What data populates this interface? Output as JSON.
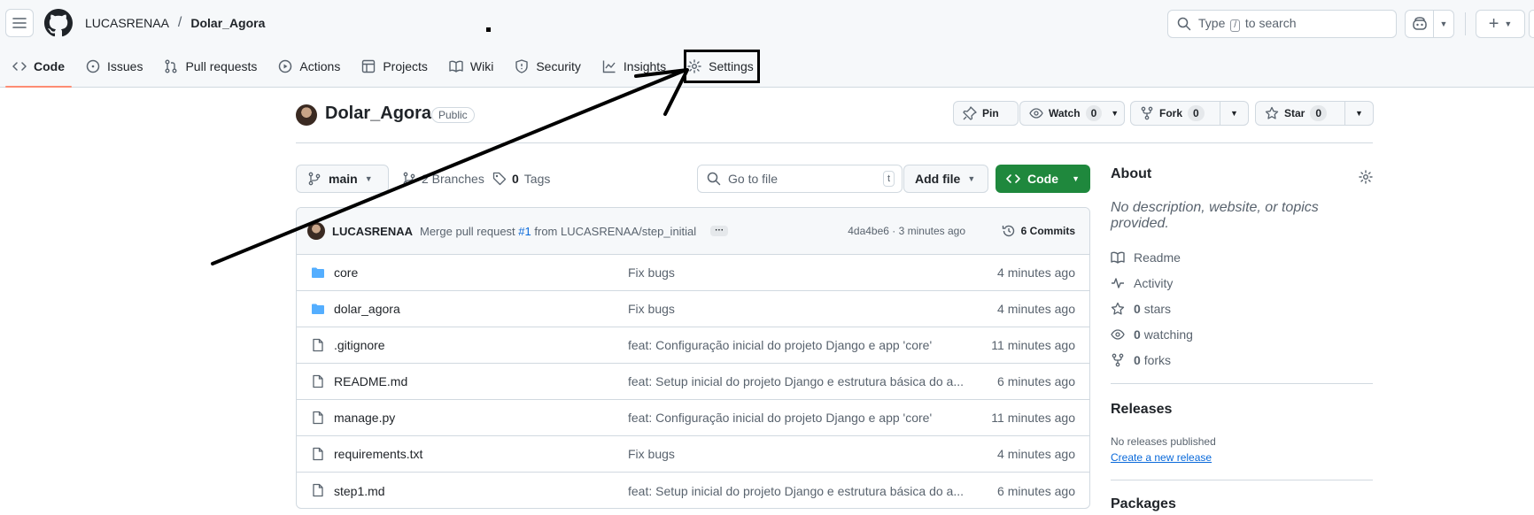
{
  "header": {
    "owner": "LUCASRENAA",
    "separator": "/",
    "repo": "Dolar_Agora",
    "search_prefix": "Type",
    "search_key": "/",
    "search_suffix": "to search"
  },
  "tabs": [
    {
      "label": "Code",
      "icon": "code-icon"
    },
    {
      "label": "Issues",
      "icon": "issue-icon"
    },
    {
      "label": "Pull requests",
      "icon": "pull-request-icon"
    },
    {
      "label": "Actions",
      "icon": "play-icon"
    },
    {
      "label": "Projects",
      "icon": "table-icon"
    },
    {
      "label": "Wiki",
      "icon": "book-icon"
    },
    {
      "label": "Security",
      "icon": "shield-icon"
    },
    {
      "label": "Insights",
      "icon": "graph-icon"
    },
    {
      "label": "Settings",
      "icon": "gear-icon"
    }
  ],
  "repo_header": {
    "name": "Dolar_Agora",
    "visibility": "Public",
    "pin": "Pin",
    "watch": "Watch",
    "watch_count": "0",
    "fork": "Fork",
    "fork_count": "0",
    "star": "Star",
    "star_count": "0"
  },
  "toolbar": {
    "branch": "main",
    "branches": "2 Branches",
    "branches_count": "2",
    "tags_count": "0",
    "tags": "Tags",
    "goto_placeholder": "Go to file",
    "goto_key": "t",
    "add_file": "Add file",
    "code": "Code"
  },
  "commit": {
    "author": "LUCASRENAA",
    "message_prefix": "Merge pull request",
    "pr": "#1",
    "message_suffix": "from LUCASRENAA/step_initial",
    "meta": "4da4be6 · 3 minutes ago",
    "commits": "6 Commits"
  },
  "files": [
    {
      "name": "core",
      "type": "folder",
      "message": "Fix bugs",
      "time": "4 minutes ago"
    },
    {
      "name": "dolar_agora",
      "type": "folder",
      "message": "Fix bugs",
      "time": "4 minutes ago"
    },
    {
      "name": ".gitignore",
      "type": "file",
      "message": "feat: Configuração inicial do projeto Django e app 'core'",
      "time": "11 minutes ago"
    },
    {
      "name": "README.md",
      "type": "file",
      "message": "feat: Setup inicial do projeto Django e estrutura básica do a...",
      "time": "6 minutes ago"
    },
    {
      "name": "manage.py",
      "type": "file",
      "message": "feat: Configuração inicial do projeto Django e app 'core'",
      "time": "11 minutes ago"
    },
    {
      "name": "requirements.txt",
      "type": "file",
      "message": "Fix bugs",
      "time": "4 minutes ago"
    },
    {
      "name": "step1.md",
      "type": "file",
      "message": "feat: Setup inicial do projeto Django e estrutura básica do a...",
      "time": "6 minutes ago"
    }
  ],
  "about": {
    "title": "About",
    "description": "No description, website, or topics provided.",
    "readme": "Readme",
    "activity": "Activity",
    "stars_count": "0",
    "stars": "stars",
    "watching_count": "0",
    "watching": "watching",
    "forks_count": "0",
    "forks": "forks"
  },
  "releases": {
    "title": "Releases",
    "none": "No releases published",
    "create": "Create a new release"
  },
  "packages": {
    "title": "Packages"
  },
  "colors": {
    "accent_underline": "#fd8c73",
    "code_button": "#1f883d",
    "link": "#0969da",
    "folder": "#54aeff"
  }
}
